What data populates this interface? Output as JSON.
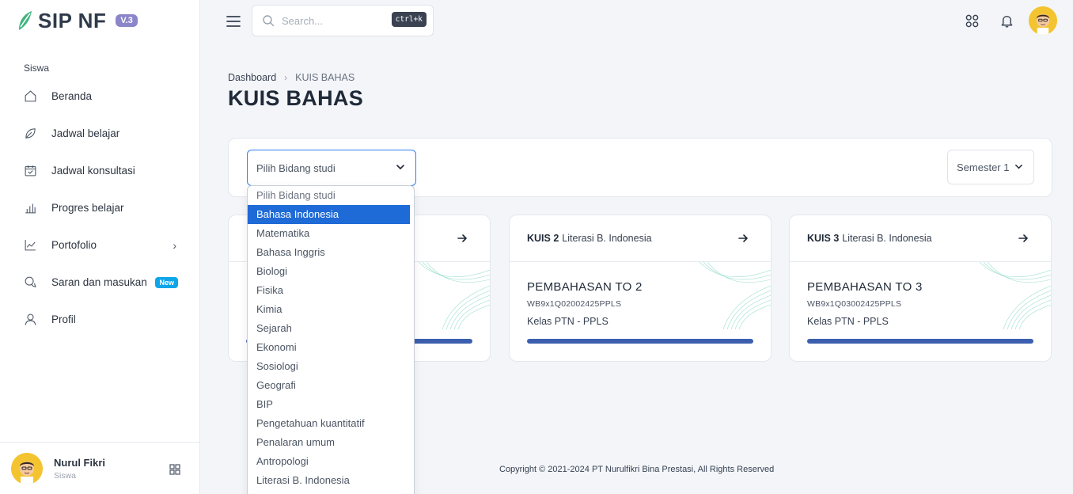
{
  "brand": {
    "name": "SIP NF",
    "version": "V.3"
  },
  "sidebar": {
    "section_label": "Siswa",
    "items": [
      {
        "label": "Beranda",
        "icon": "home-icon"
      },
      {
        "label": "Jadwal belajar",
        "icon": "leaf-icon"
      },
      {
        "label": "Jadwal konsultasi",
        "icon": "calendar-check-icon"
      },
      {
        "label": "Progres belajar",
        "icon": "bar-chart-icon"
      },
      {
        "label": "Portofolio",
        "icon": "line-chart-icon",
        "chevron": "›"
      },
      {
        "label": "Saran dan masukan",
        "icon": "chat-icon",
        "badge": "New"
      },
      {
        "label": "Profil",
        "icon": "user-icon"
      }
    ],
    "user": {
      "name": "Nurul Fikri",
      "role": "Siswa"
    }
  },
  "topbar": {
    "search_placeholder": "Search...",
    "shortcut": "ctrl+k"
  },
  "breadcrumb": {
    "root": "Dashboard",
    "separator": "›",
    "current": "KUIS BAHAS"
  },
  "page_title": "KUIS BAHAS",
  "filter": {
    "bidang_selected": "Pilih Bidang studi",
    "semester_selected": "Semester 1"
  },
  "dropdown_options": [
    "Pilih Bidang studi",
    "Bahasa Indonesia",
    "Matematika",
    "Bahasa Inggris",
    "Biologi",
    "Fisika",
    "Kimia",
    "Sejarah",
    "Ekonomi",
    "Sosiologi",
    "Geografi",
    "BIP",
    "Pengetahuan kuantitatif",
    "Penalaran umum",
    "Antropologi",
    "Literasi B. Indonesia"
  ],
  "dropdown_highlighted": "Bahasa Indonesia",
  "quizzes": [
    {
      "kuis": "",
      "subject": "",
      "title": "",
      "code": "",
      "kelas": ""
    },
    {
      "kuis": "KUIS 2",
      "subject": "Literasi B. Indonesia",
      "title": "PEMBAHASAN TO 2",
      "code": "WB9x1Q02002425PPLS",
      "kelas": "Kelas PTN - PPLS"
    },
    {
      "kuis": "KUIS 3",
      "subject": "Literasi B. Indonesia",
      "title": "PEMBAHASAN TO 3",
      "code": "WB9x1Q03002425PPLS",
      "kelas": "Kelas PTN - PPLS"
    }
  ],
  "footer": {
    "copyright": "Copyright © 2021-2024 PT Nurulfikri Bina Prestasi, All Rights Reserved"
  },
  "colors": {
    "accent": "#2f80ed",
    "progress": "#3b5fae",
    "badge": "#0ea5e9",
    "selected_option": "#1e6ad6",
    "brand_green": "#3fb37f"
  }
}
